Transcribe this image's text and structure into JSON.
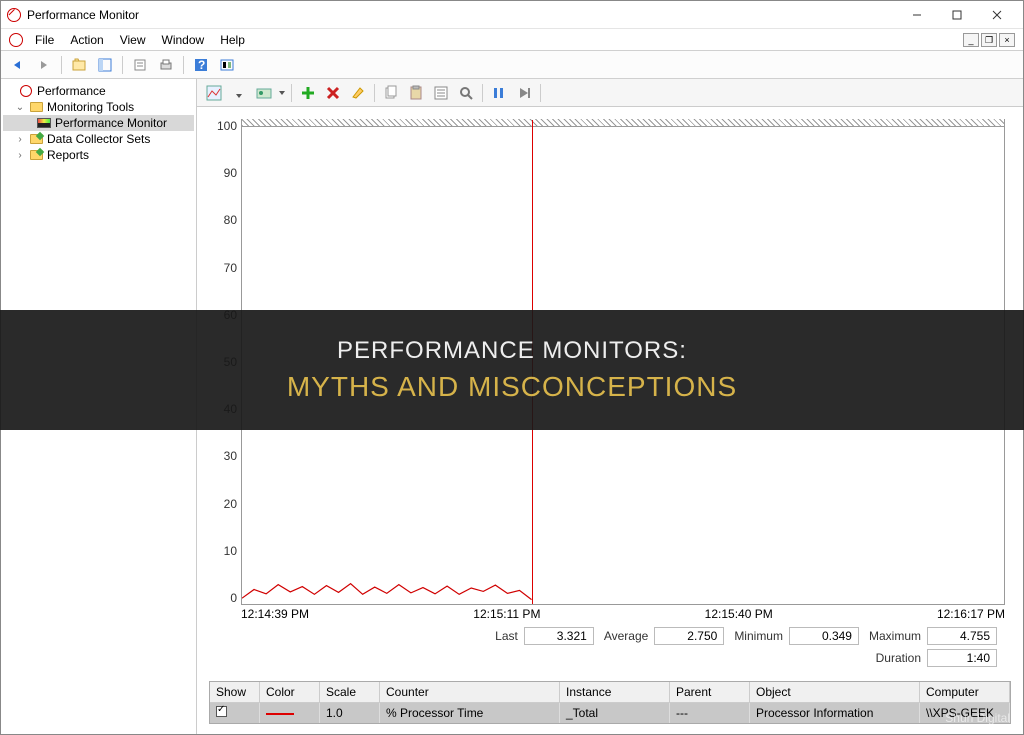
{
  "window": {
    "title": "Performance Monitor"
  },
  "menu": {
    "file": "File",
    "action": "Action",
    "view": "View",
    "window": "Window",
    "help": "Help"
  },
  "tree": {
    "root": "Performance",
    "monitoring": "Monitoring Tools",
    "perfmon": "Performance Monitor",
    "dcs": "Data Collector Sets",
    "reports": "Reports"
  },
  "chart_data": {
    "type": "line",
    "title": "",
    "xlabel": "",
    "ylabel": "",
    "ylim": [
      0,
      100
    ],
    "y_ticks": [
      100,
      90,
      80,
      70,
      60,
      50,
      40,
      30,
      20,
      10,
      0
    ],
    "x_ticks": [
      "12:14:39 PM",
      "12:15:11 PM",
      "12:15:40 PM",
      "12:16:17 PM"
    ],
    "cursor_x_fraction": 0.38,
    "series": [
      {
        "name": "% Processor Time",
        "color": "#d00000",
        "values": [
          1.2,
          3.0,
          2.1,
          4.0,
          2.5,
          3.6,
          2.0,
          3.8,
          2.4,
          4.2,
          2.0,
          3.5,
          2.2,
          4.0,
          2.3,
          3.4,
          2.1,
          3.7,
          2.0,
          3.3,
          2.6,
          3.9,
          2.2,
          2.8,
          0.9
        ]
      }
    ]
  },
  "stats": {
    "labels": {
      "last": "Last",
      "avg": "Average",
      "min": "Minimum",
      "max": "Maximum",
      "dur": "Duration"
    },
    "last": "3.321",
    "avg": "2.750",
    "min": "0.349",
    "max": "4.755",
    "dur": "1:40"
  },
  "grid": {
    "headers": {
      "show": "Show",
      "color": "Color",
      "scale": "Scale",
      "counter": "Counter",
      "instance": "Instance",
      "parent": "Parent",
      "object": "Object",
      "computer": "Computer"
    },
    "row": {
      "show": true,
      "scale": "1.0",
      "counter": "% Processor Time",
      "instance": "_Total",
      "parent": "---",
      "object": "Processor Information",
      "computer": "\\\\XPS-GEEK"
    }
  },
  "overlay": {
    "line1": "PERFORMANCE MONITORS:",
    "line2": "MYTHS AND MISCONCEPTIONS"
  },
  "watermark": "Shun Digital"
}
